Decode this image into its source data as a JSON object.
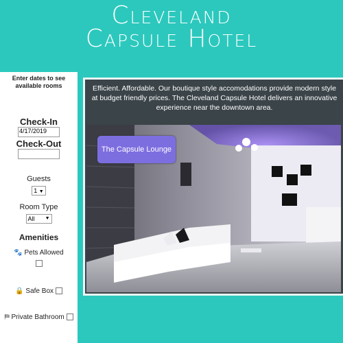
{
  "header": {
    "title_line1": "Cleveland",
    "title_line2": "Capsule Hotel"
  },
  "sidebar": {
    "prompt": "Enter dates to see available rooms",
    "checkin_label": "Check-In",
    "checkin_value": "4/17/2019",
    "checkout_label": "Check-Out",
    "checkout_value": "",
    "guests_label": "Guests",
    "guests_value": "1",
    "room_type_label": "Room Type",
    "room_type_value": "All",
    "amenities_label": "Amenities",
    "amenities": [
      {
        "label": "Pets Allowed",
        "icon": "paw-icon",
        "checked": false
      },
      {
        "label": "Safe Box",
        "icon": "lock-icon",
        "checked": false
      },
      {
        "label": "Private Bathroom",
        "icon": "bath-icon",
        "checked": false
      }
    ]
  },
  "main": {
    "description": "Efficient. Affordable. Our boutique style accomodations provide modern style at budget friendly prices. The Cleveland Capsule Hotel delivers an innovative experience near the downtown area.",
    "lounge_button": "The Capsule Lounge"
  },
  "colors": {
    "background": "#2cc8bd",
    "panel": "#3b4449",
    "button": "#7d6ee0"
  }
}
